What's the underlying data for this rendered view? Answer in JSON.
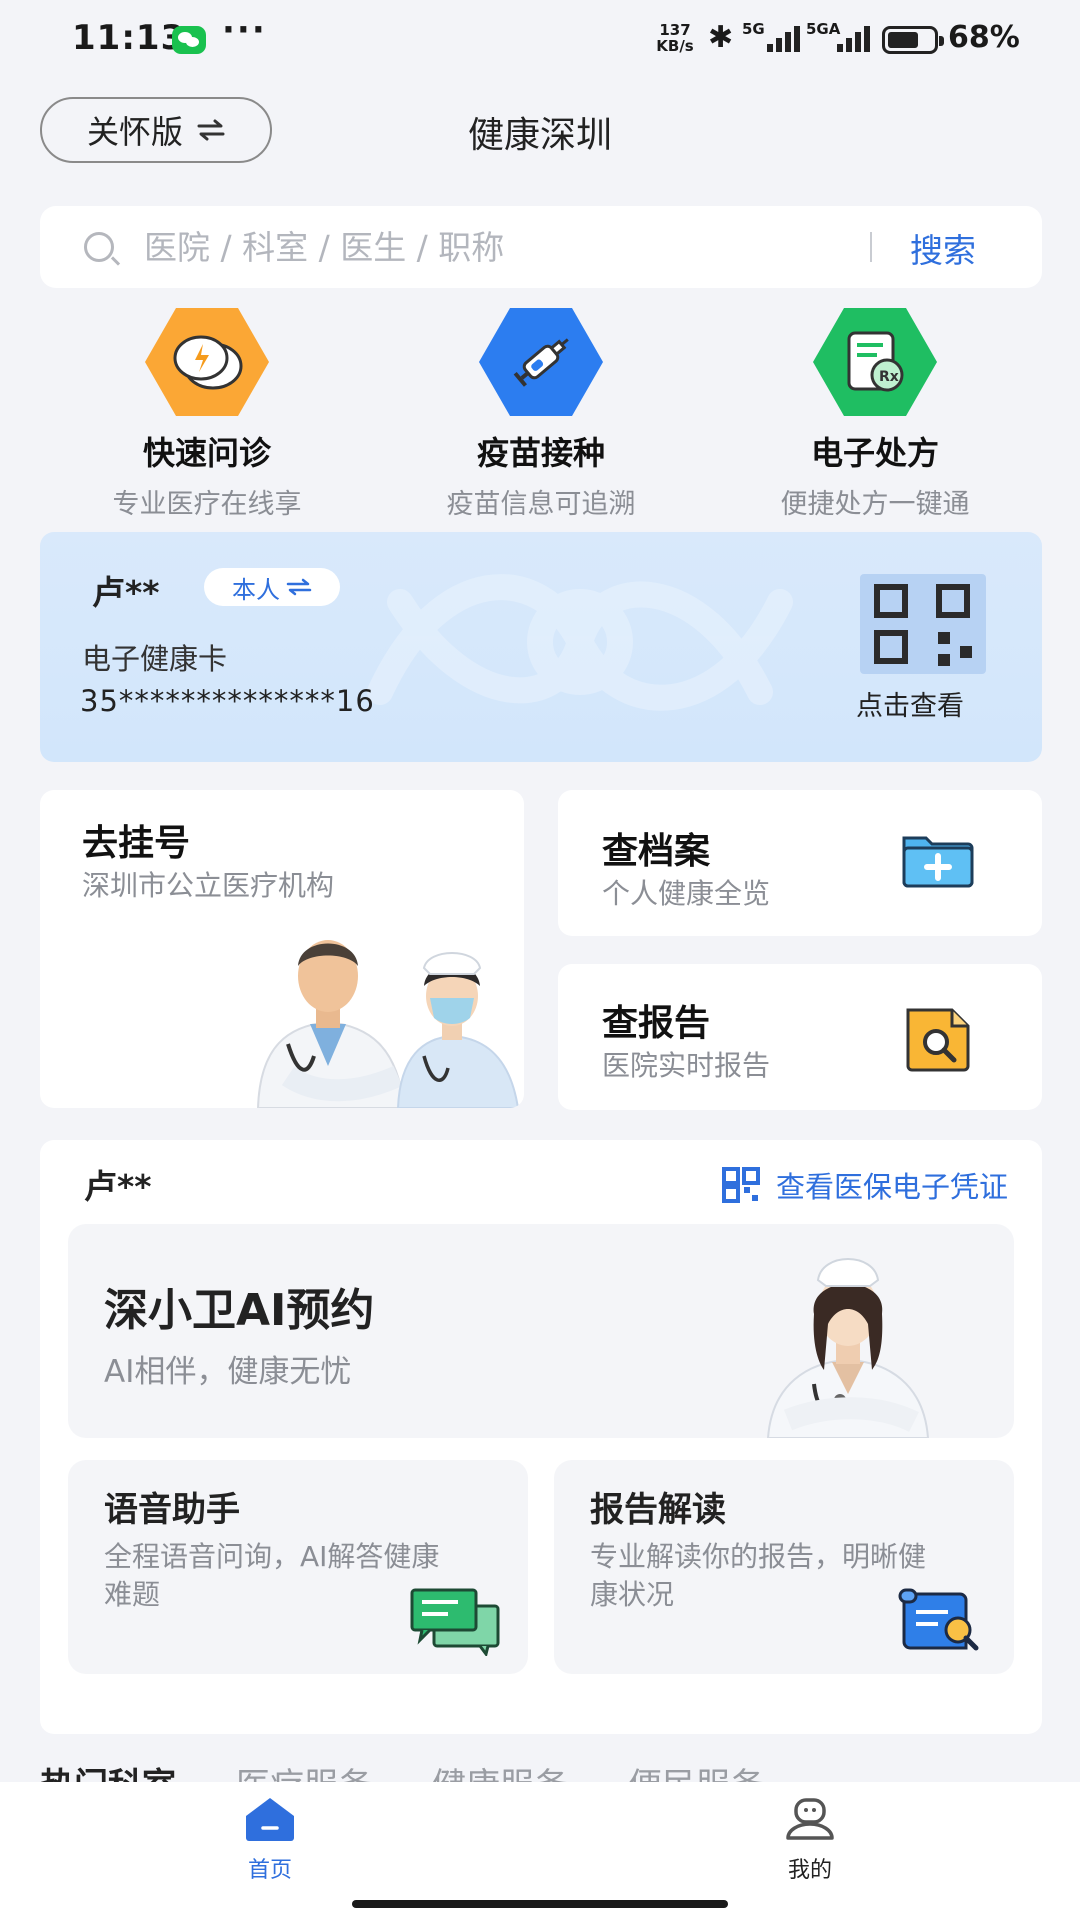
{
  "status_bar": {
    "time": "11:13",
    "dots": "···",
    "net_speed": "137",
    "net_unit": "KB/s",
    "sim1_label": "5G",
    "sim2_label": "5GA",
    "battery_level": 0.68,
    "battery_text": "68%"
  },
  "header": {
    "care_label": "关怀版",
    "title": "健康深圳"
  },
  "search": {
    "placeholder": "医院 / 科室 / 医生 / 职称",
    "button": "搜索"
  },
  "quick_services": [
    {
      "title": "快速问诊",
      "subtitle": "专业医疗在线享",
      "icon": "chat-lightning-icon",
      "color": "#fba735"
    },
    {
      "title": "疫苗接种",
      "subtitle": "疫苗信息可追溯",
      "icon": "syringe-icon",
      "color": "#2c7df0"
    },
    {
      "title": "电子处方",
      "subtitle": "便捷处方一键通",
      "icon": "prescription-icon",
      "color": "#1fbe62"
    }
  ],
  "health_card": {
    "name": "卢**",
    "relation": "本人",
    "label": "电子健康卡",
    "number": "35**************16",
    "qr_label": "点击查看"
  },
  "services": {
    "register": {
      "title": "去挂号",
      "subtitle": "深圳市公立医疗机构"
    },
    "records": {
      "title": "查档案",
      "subtitle": "个人健康全览"
    },
    "report": {
      "title": "查报告",
      "subtitle": "医院实时报告"
    }
  },
  "ai_section": {
    "name": "卢**",
    "insurance_link": "查看医保电子凭证",
    "banner_title": "深小卫AI预约",
    "banner_subtitle": "AI相伴，健康无忧",
    "cards": [
      {
        "title": "语音助手",
        "subtitle": "全程语音问询，AI解答健康难题"
      },
      {
        "title": "报告解读",
        "subtitle": "专业解读你的报告，明晰健康状况"
      }
    ]
  },
  "category_tabs": [
    "热门科室",
    "医疗服务",
    "健康服务",
    "便民服务"
  ],
  "bottom_nav": [
    {
      "label": "首页",
      "active": true
    },
    {
      "label": "我的",
      "active": false
    }
  ],
  "colors": {
    "accent": "#2f6fdd",
    "background": "#f3f4f8"
  }
}
